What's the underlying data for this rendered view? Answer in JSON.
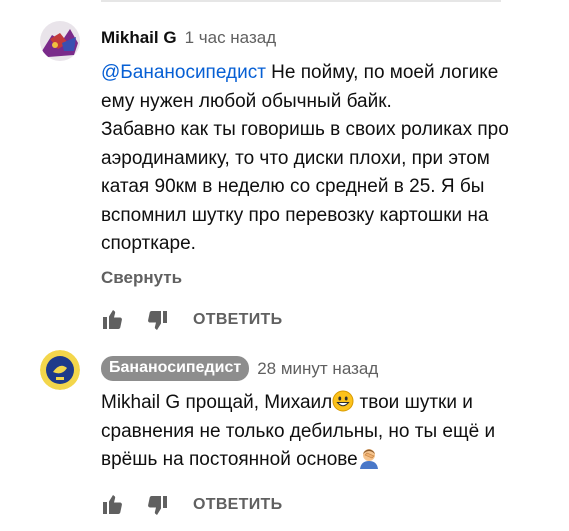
{
  "comment": {
    "author": "Mikhail G",
    "time": "1 час назад",
    "mention": "@Бананосипедист",
    "line1_rest": " Не пойму, по моей логике",
    "lines": [
      "ему нужен любой обычный байк.",
      "Забавно как ты говоришь в своих роликах про",
      "аэродинамику, то что диски плохи, при этом",
      "катая 90км в неделю со средней в 25. Я бы",
      "вспомнил шутку про перевозку картошки на",
      "спорткаре."
    ],
    "collapse_label": "Свернуть",
    "reply_label": "ОТВЕТИТЬ"
  },
  "reply": {
    "author": "Бананосипедист",
    "time": "28 минут назад",
    "line1_a": "Mikhail G прощай, Михаил",
    "line1_b": " твои шутки и",
    "line2": "сравнения не только дебильны, но ты ещё и",
    "line3": "врёшь на постоянной основе",
    "reply_label": "ОТВЕТИТЬ",
    "emojis": [
      "grinning-face-emoji",
      "person-facepalming-emoji"
    ]
  },
  "icons": [
    "like-icon",
    "dislike-icon"
  ],
  "colors": {
    "mention": "#065fd4",
    "secondary_text": "#606060",
    "author_chip_bg": "#8d8d8d"
  }
}
